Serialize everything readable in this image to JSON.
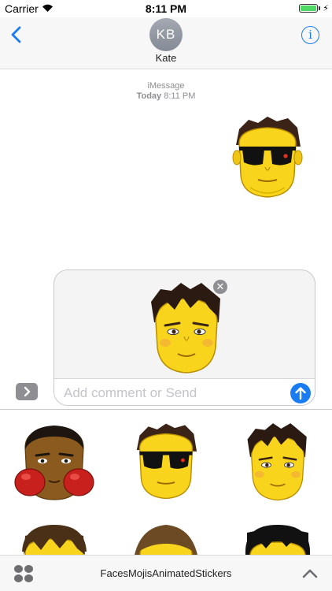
{
  "status_bar": {
    "carrier": "Carrier",
    "time": "8:11 PM",
    "battery_level": 1.0,
    "battery_color": "#4cd964",
    "icons": [
      "wifi-icon",
      "battery-icon",
      "charging-bolt-icon"
    ]
  },
  "header": {
    "back_icon": "chevron-left-icon",
    "avatar_initials": "KB",
    "contact_name": "Kate",
    "info_icon": "info-icon",
    "info_glyph": "i",
    "accent_color": "#1a7cf2"
  },
  "conversation": {
    "service_label": "iMessage",
    "day_label": "Today",
    "time_label": "8:11 PM",
    "sent_sticker": "sunglasses-face-sticker"
  },
  "compose": {
    "placeholder": "Add comment or Send",
    "remove_glyph": "✕",
    "attached_sticker": "black-hair-face-sticker",
    "send_icon": "arrow-up-icon",
    "expand_icon": "chevron-right-icon"
  },
  "sticker_drawer": {
    "stickers": [
      "boxer-sticker",
      "sunglasses-face-sticker",
      "black-hair-face-sticker",
      "brown-hair-face-sticker",
      "long-hair-face-sticker",
      "dark-hair-face-sticker"
    ]
  },
  "bottom_bar": {
    "apps_icon": "app-grid-icon",
    "app_name": "FacesMojisAnimatedStickers",
    "collapse_icon": "chevron-up-icon"
  }
}
